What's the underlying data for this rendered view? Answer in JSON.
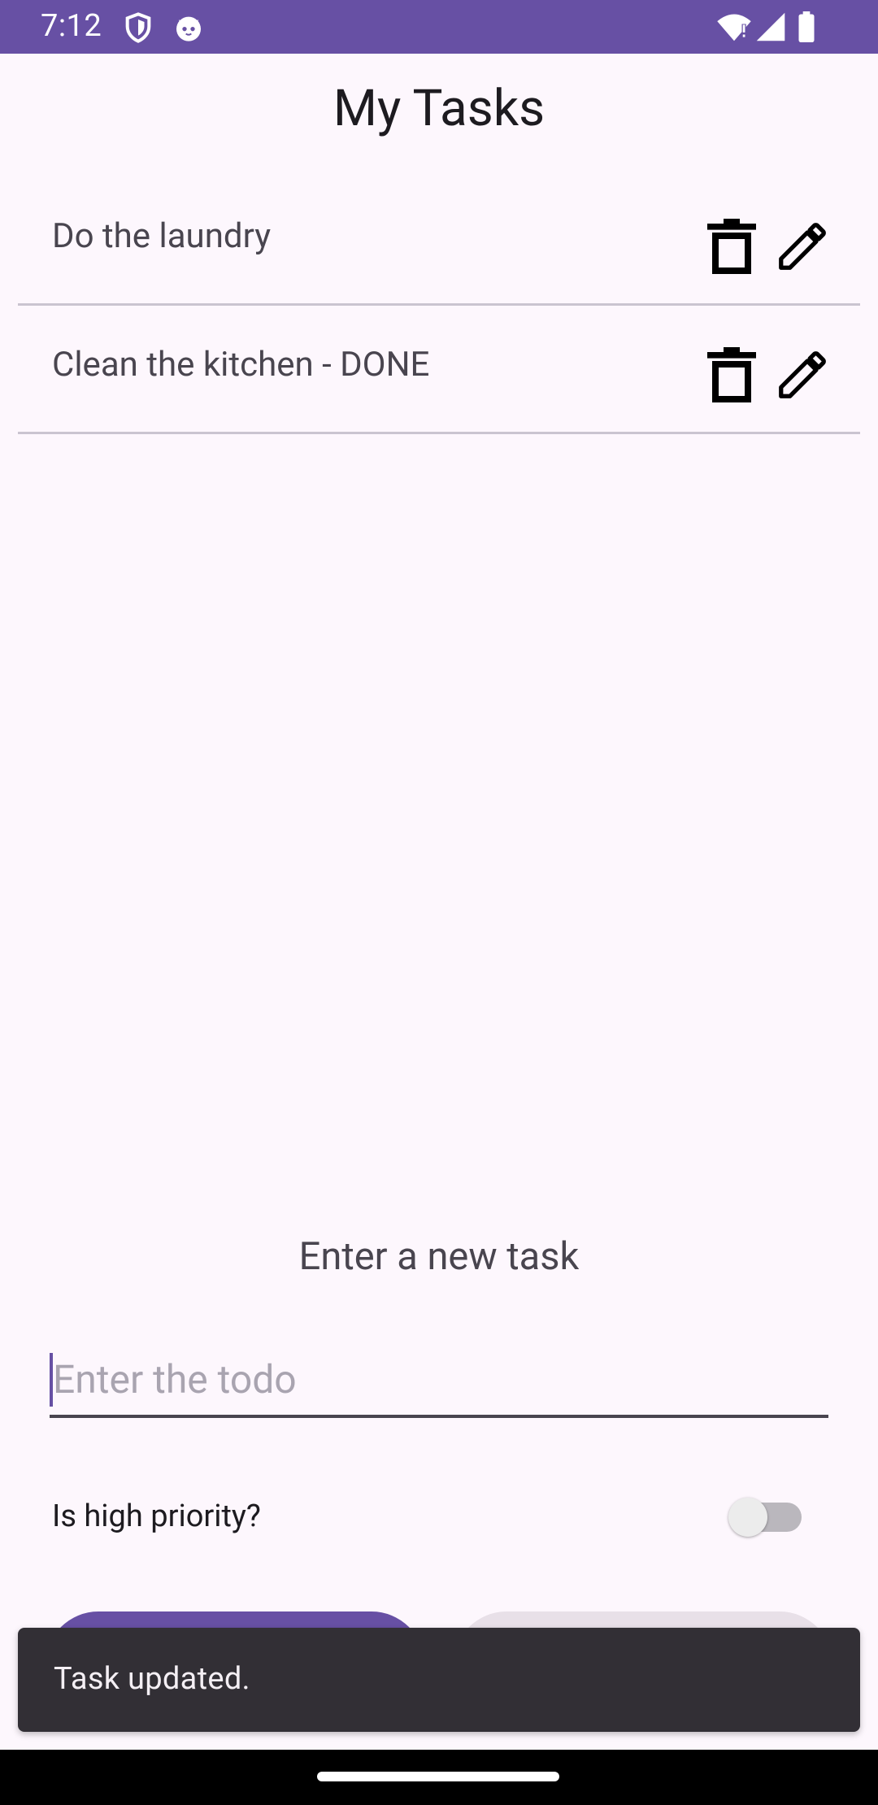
{
  "status_bar": {
    "time": "7:12",
    "left_icons": [
      "shield-icon",
      "cat-notification-icon"
    ],
    "right_icons": [
      "wifi-alert-icon",
      "cellular-signal-icon",
      "battery-icon"
    ],
    "background": "#6750a4"
  },
  "header": {
    "title": "My Tasks"
  },
  "tasks": [
    {
      "label": "Do the laundry",
      "delete_icon": "trash-icon",
      "edit_icon": "pencil-icon"
    },
    {
      "label": "Clean the kitchen - DONE",
      "delete_icon": "trash-icon",
      "edit_icon": "pencil-icon"
    }
  ],
  "form": {
    "heading": "Enter a new task",
    "todo_value": "",
    "todo_placeholder": "Enter the todo",
    "priority_label": "Is high priority?",
    "priority_checked": false
  },
  "snackbar": {
    "message": "Task updated."
  },
  "colors": {
    "primary": "#6750a4",
    "background": "#fdf7fd",
    "snackbar": "#322f35",
    "divider": "#cac4d0"
  }
}
